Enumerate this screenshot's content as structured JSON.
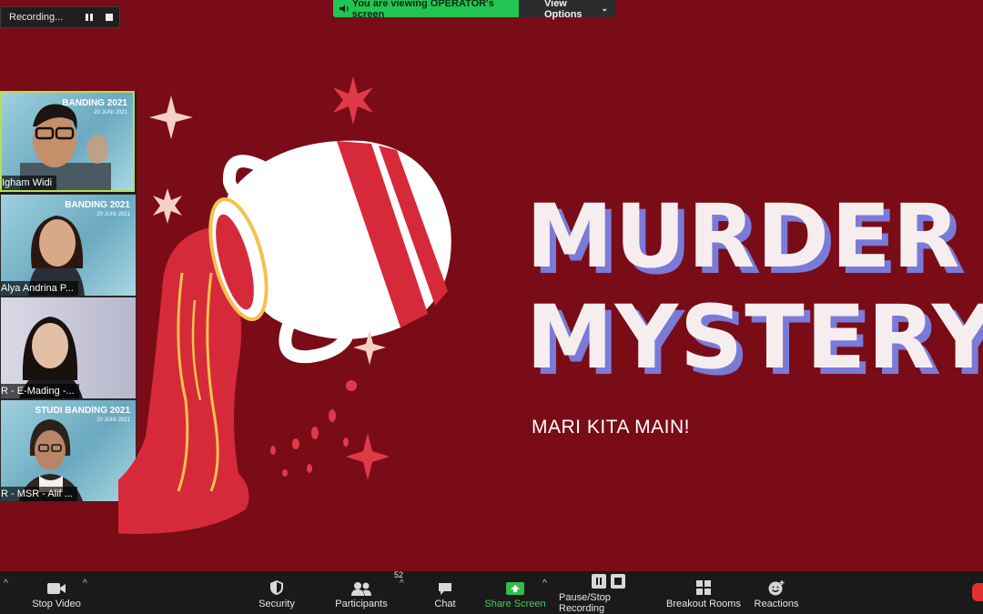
{
  "recording": {
    "label": "Recording..."
  },
  "banner": {
    "viewing_text": "You are viewing OPERATOR's screen",
    "view_options": "View Options"
  },
  "participants_panel": {
    "tiles": [
      {
        "name": "Igham Widi",
        "event_title": "BANDING 2021",
        "event_date": "20 JUNI 2021"
      },
      {
        "name": "Alya Andrina P...",
        "event_title": "BANDING 2021",
        "event_date": "20 JUNI 2021"
      },
      {
        "name": "R - E-Mading -...",
        "event_title": "",
        "event_date": ""
      },
      {
        "name": "R - MSR - Alif ...",
        "event_title": "STUDI BANDING 2021",
        "event_date": "20 JUNI 2021"
      }
    ]
  },
  "slide": {
    "title_line1": "MURDER",
    "title_line2": "MYSTERY",
    "subtitle": "MARI KITA MAIN!"
  },
  "toolbar": {
    "stop_video": "Stop Video",
    "security": "Security",
    "participants": "Participants",
    "participants_count": "52",
    "chat": "Chat",
    "share_screen": "Share Screen",
    "pause_stop_recording": "Pause/Stop Recording",
    "breakout_rooms": "Breakout Rooms",
    "reactions": "Reactions"
  },
  "colors": {
    "slide_bg": "#7a0c17",
    "accent_shadow": "#7a7ad8",
    "share_green": "#45d05a",
    "banner_green": "#23c552"
  },
  "icons": [
    "pause-icon",
    "stop-icon",
    "speaker-icon",
    "chevron-down-icon",
    "camera-icon",
    "shield-icon",
    "people-icon",
    "chat-icon",
    "share-arrow-icon",
    "breakout-grid-icon",
    "reaction-icon"
  ]
}
